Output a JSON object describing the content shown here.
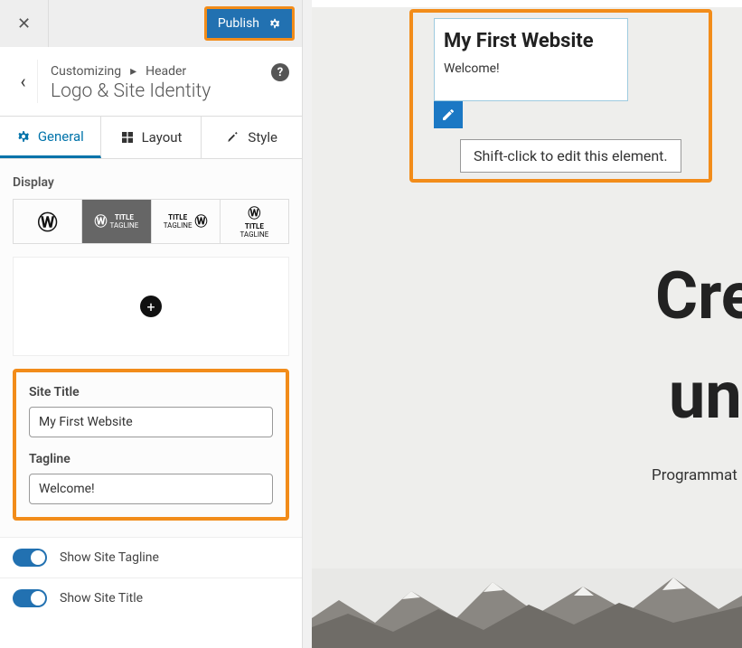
{
  "topbar": {
    "publish_label": "Publish"
  },
  "breadcrumb": {
    "prefix": "Customizing",
    "parent": "Header",
    "title": "Logo & Site Identity"
  },
  "tabs": {
    "general": "General",
    "layout": "Layout",
    "style": "Style"
  },
  "display": {
    "label": "Display",
    "cell1": "",
    "cell2_line1": "TITLE",
    "cell2_line2": "TAGLINE",
    "cell3_line1": "TITLE",
    "cell3_line2": "TAGLINE",
    "cell4_line1": "TITLE",
    "cell4_line2": "TAGLINE"
  },
  "form": {
    "site_title_label": "Site Title",
    "site_title_value": "My First Website",
    "tagline_label": "Tagline",
    "tagline_value": "Welcome!"
  },
  "toggles": {
    "show_tagline": "Show Site Tagline",
    "show_title": "Show Site Title"
  },
  "preview": {
    "site_title": "My First Website",
    "site_tagline": "Welcome!",
    "tooltip": "Shift-click to edit this element.",
    "hero1": "Cre",
    "hero2": "un",
    "subtitle": "Programmat"
  }
}
